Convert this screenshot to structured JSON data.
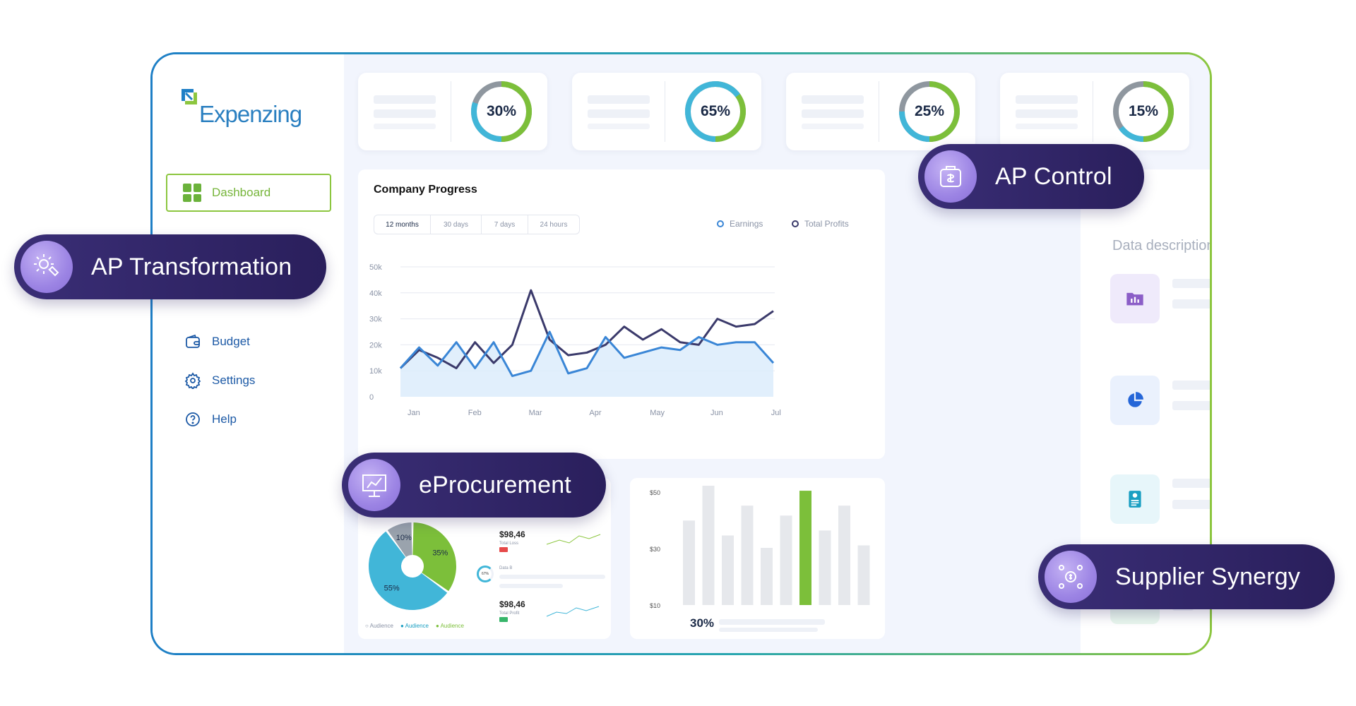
{
  "app": {
    "logo_text": "Expenzing"
  },
  "sidebar": {
    "dashboard_label": "Dashboard",
    "items": [
      {
        "label": "Budget",
        "icon": "wallet-icon"
      },
      {
        "label": "Settings",
        "icon": "gear-icon"
      },
      {
        "label": "Help",
        "icon": "help-icon"
      }
    ]
  },
  "kpis": [
    {
      "value": "30%",
      "fraction": 0.3
    },
    {
      "value": "65%",
      "fraction": 0.65
    },
    {
      "value": "25%",
      "fraction": 0.25
    },
    {
      "value": "15%",
      "fraction": 0.15
    }
  ],
  "company_progress": {
    "title": "Company Progress",
    "ranges": [
      "12 months",
      "30 days",
      "7 days",
      "24 hours"
    ],
    "legend": [
      "Earnings",
      "Total Profits"
    ]
  },
  "chart_data": {
    "type": "line",
    "x": [
      "Jan",
      "Feb",
      "Mar",
      "Apr",
      "May",
      "Jun",
      "Jul"
    ],
    "yticks": [
      "50k",
      "40k",
      "30k",
      "20k",
      "10k",
      "0"
    ],
    "ylim": [
      0,
      50000
    ],
    "series": [
      {
        "name": "Earnings",
        "values": [
          11000,
          19000,
          12000,
          21000,
          11000,
          21000,
          8000,
          10000,
          25000,
          9000,
          11000,
          23000,
          15000,
          17000,
          19000,
          18000,
          23000,
          20000,
          21000,
          21000,
          13000
        ]
      },
      {
        "name": "Total Profits",
        "values": [
          11000,
          18000,
          15000,
          11000,
          21000,
          13000,
          20000,
          41000,
          22000,
          16000,
          17000,
          20000,
          27000,
          22000,
          26000,
          21000,
          20000,
          30000,
          27000,
          28000,
          33000
        ]
      }
    ],
    "grid": true
  },
  "right_panel": {
    "header": "AP Control",
    "description": "Data description here"
  },
  "pills": {
    "ap_transformation": "AP Transformation",
    "ap_control": "AP Control",
    "eprocurement": "eProcurement",
    "supplier_synergy": "Supplier Synergy"
  },
  "pie": {
    "slices": [
      {
        "label": "10%",
        "value": 10,
        "color": "#9aa3ad"
      },
      {
        "label": "35%",
        "value": 35,
        "color": "#7cbf3a"
      },
      {
        "label": "55%",
        "value": 55,
        "color": "#41b6d8"
      }
    ],
    "legend": [
      "Audience",
      "Audience",
      "Audience"
    ]
  },
  "mini": {
    "amount1": "$98,46",
    "sub1": "Total Loss",
    "amount2": "$98,46",
    "sub2": "Total Profit",
    "data_b": "Data B",
    "donut": "67%"
  },
  "bars": {
    "yticks": [
      "$50",
      "$30",
      "$10"
    ],
    "values": [
      34,
      48,
      28,
      40,
      23,
      36,
      46,
      30,
      40,
      24
    ],
    "highlight": 6,
    "footer": "30%"
  }
}
